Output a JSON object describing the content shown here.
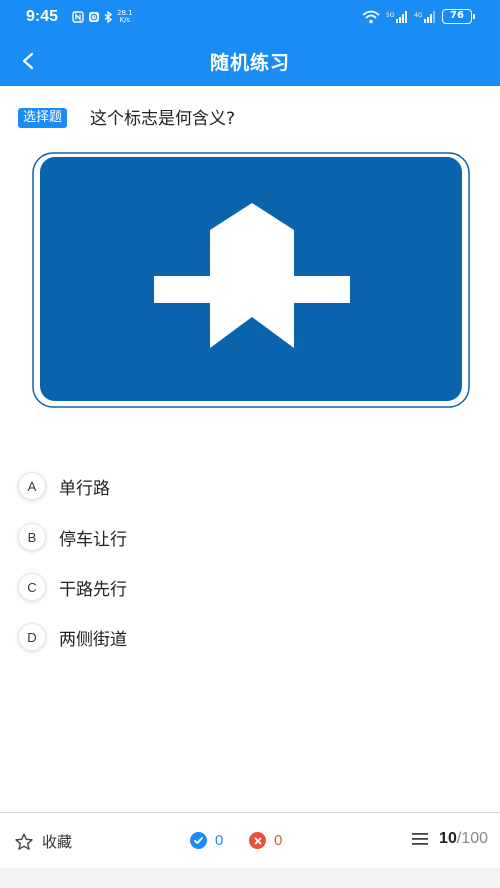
{
  "status_bar": {
    "time": "9:45",
    "net_speed_value": "28.1",
    "net_speed_unit": "K/s",
    "battery": "76"
  },
  "nav": {
    "title": "随机练习"
  },
  "question": {
    "type_label": "选择题",
    "text": "这个标志是何含义?",
    "sign_colors": {
      "background": "#0a64ad",
      "symbol": "#ffffff"
    },
    "options": [
      {
        "letter": "A",
        "text": "单行路"
      },
      {
        "letter": "B",
        "text": "停车让行"
      },
      {
        "letter": "C",
        "text": "干路先行"
      },
      {
        "letter": "D",
        "text": "两侧街道"
      }
    ]
  },
  "bottom": {
    "favorite_label": "收藏",
    "correct_count": "0",
    "wrong_count": "0",
    "current": "10",
    "separator": "/",
    "total": "100"
  },
  "colors": {
    "primary": "#1a8cf5",
    "correct": "#1a8cf5",
    "wrong": "#e8543a"
  }
}
